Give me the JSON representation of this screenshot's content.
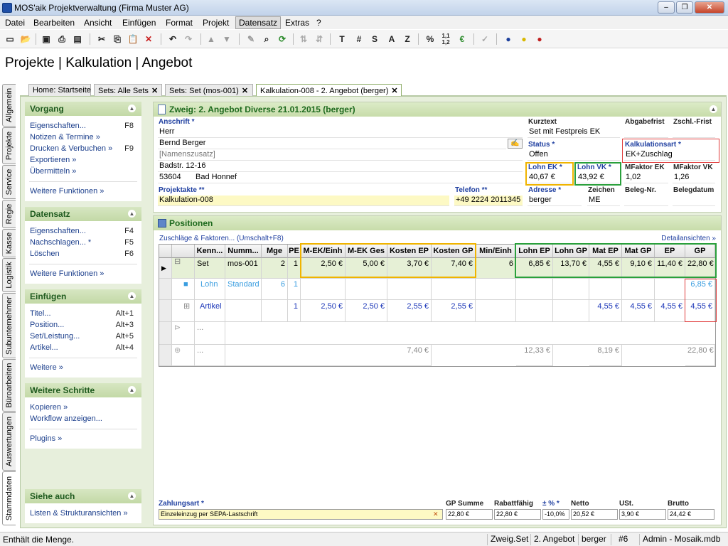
{
  "window": {
    "title": "MOS'aik Projektverwaltung (Firma Muster AG)"
  },
  "menu": [
    "Datei",
    "Bearbeiten",
    "Ansicht",
    "Einfügen",
    "Format",
    "Projekt",
    "Datensatz",
    "Extras",
    "?"
  ],
  "toolbar": {
    "letter_buttons": [
      "T",
      "#",
      "S",
      "A",
      "Z",
      "%"
    ]
  },
  "page_title": "Projekte | Kalkulation | Angebot",
  "side_tabs": [
    "Allgemein",
    "Projekte",
    "Service",
    "Regie",
    "Kasse",
    "Logistik",
    "Subunternehmer",
    "Büroarbeiten",
    "Auswertungen",
    "Stammdaten"
  ],
  "doc_tabs": [
    "Home: Startseite",
    "Sets: Alle Sets",
    "Sets: Set (mos-001)",
    "Kalkulation-008 - 2. Angebot (berger)"
  ],
  "sidebar": {
    "vorgang": {
      "title": "Vorgang",
      "items": [
        {
          "label": "Eigenschaften...",
          "key": "F8"
        },
        {
          "label": "Notizen & Termine »",
          "key": ""
        },
        {
          "label": "Drucken & Verbuchen »",
          "key": "F9"
        },
        {
          "label": "Exportieren »",
          "key": ""
        },
        {
          "label": "Übermitteln »",
          "key": ""
        }
      ],
      "more": "Weitere Funktionen »"
    },
    "datensatz": {
      "title": "Datensatz",
      "items": [
        {
          "label": "Eigenschaften...",
          "key": "F4"
        },
        {
          "label": "Nachschlagen... *",
          "key": "F5"
        },
        {
          "label": "Löschen",
          "key": "F6"
        }
      ],
      "more": "Weitere Funktionen »"
    },
    "einfuegen": {
      "title": "Einfügen",
      "items": [
        {
          "label": "Titel...",
          "key": "Alt+1"
        },
        {
          "label": "Position...",
          "key": "Alt+3"
        },
        {
          "label": "Set/Leistung...",
          "key": "Alt+5"
        },
        {
          "label": "Artikel...",
          "key": "Alt+4"
        }
      ],
      "more": "Weitere »"
    },
    "weitere": {
      "title": "Weitere Schritte",
      "items": [
        {
          "label": "Kopieren »",
          "key": ""
        },
        {
          "label": "Workflow anzeigen...",
          "key": ""
        }
      ],
      "more": "Plugins »"
    },
    "siehe": {
      "title": "Siehe auch",
      "items": [
        {
          "label": "Listen & Strukturansichten »",
          "key": ""
        }
      ]
    }
  },
  "header": {
    "title": "Zweig: 2. Angebot Diverse 21.01.2015 (berger)",
    "anschrift_label": "Anschrift *",
    "anrede": "Herr",
    "name": "Bernd Berger",
    "namenszusatz_placeholder": "[Namenszusatz]",
    "strasse": "Badstr. 12-16",
    "plz": "53604",
    "ort": "Bad Honnef",
    "projektakte_label": "Projektakte **",
    "projektakte": "Kalkulation-008",
    "telefon_label": "Telefon **",
    "telefon": "+49 2224 2011345",
    "kurztext_label": "Kurztext",
    "kurztext": "Set mit Festpreis EK",
    "abgabefrist_label": "Abgabefrist",
    "zschl_label": "Zschl.-Frist",
    "status_label": "Status *",
    "status": "Offen",
    "kalkart_label": "Kalkulationsart *",
    "kalkart": "EK+Zuschlag",
    "lohn_ek_label": "Lohn EK *",
    "lohn_ek": "40,67 €",
    "lohn_vk_label": "Lohn VK *",
    "lohn_vk": "43,92 €",
    "mfaktor_ek_label": "MFaktor EK",
    "mfaktor_ek": "1,02",
    "mfaktor_vk_label": "MFaktor VK",
    "mfaktor_vk": "1,26",
    "adresse_label": "Adresse *",
    "adresse": "berger",
    "zeichen_label": "Zeichen",
    "zeichen": "ME",
    "belegnr_label": "Beleg-Nr.",
    "belegdatum_label": "Belegdatum"
  },
  "positions": {
    "title": "Positionen",
    "zuschlaege_link": "Zuschläge & Faktoren... (Umschalt+F8)",
    "details_link": "Detailansichten »",
    "columns": [
      "Kenn...",
      "Numm...",
      "Mge",
      "PE",
      "M-EK/Einh",
      "M-EK Ges",
      "Kosten EP",
      "Kosten GP",
      "Min/Einh",
      "Lohn EP",
      "Lohn GP",
      "Mat EP",
      "Mat GP",
      "EP",
      "GP"
    ],
    "rows": [
      [
        "Set",
        "mos-001",
        "2",
        "1",
        "2,50 €",
        "5,00 €",
        "3,70 €",
        "7,40 €",
        "6",
        "6,85 €",
        "13,70 €",
        "4,55 €",
        "9,10 €",
        "11,40 €",
        "22,80 €"
      ],
      [
        "Lohn",
        "Standard",
        "6",
        "1",
        "",
        "",
        "",
        "",
        "",
        "",
        "",
        "",
        "",
        "",
        "6,85 €"
      ],
      [
        "Artikel",
        "",
        "",
        "1",
        "2,50 €",
        "2,50 €",
        "2,55 €",
        "2,55 €",
        "",
        "",
        "",
        "4,55 €",
        "4,55 €",
        "4,55 €",
        "4,55 €"
      ],
      [
        "...",
        "",
        "",
        "",
        "",
        "",
        "",
        "",
        "",
        "",
        "",
        "",
        "",
        "",
        ""
      ],
      [
        "...",
        "",
        "",
        "",
        "",
        "",
        "",
        "7,40 €",
        "",
        "",
        "12,33 €",
        "",
        "8,19 €",
        "",
        "22,80 €"
      ]
    ]
  },
  "footer": {
    "zahlungsart_label": "Zahlungsart *",
    "zahlungsart": "Einzeleinzug per SEPA-Lastschrift",
    "labels": [
      "GP Summe",
      "Rabattfähig",
      "± % *",
      "Netto",
      "USt.",
      "Brutto"
    ],
    "values": [
      "22,80 €",
      "22,80 €",
      "-10,0%",
      "20,52 €",
      "3,90 €",
      "24,42 €"
    ]
  },
  "statusbar": {
    "message": "Enthält die Menge.",
    "cells": [
      "Zweig.Set",
      "2. Angebot",
      "berger",
      "#6",
      "Admin - Mosaik.mdb"
    ]
  }
}
